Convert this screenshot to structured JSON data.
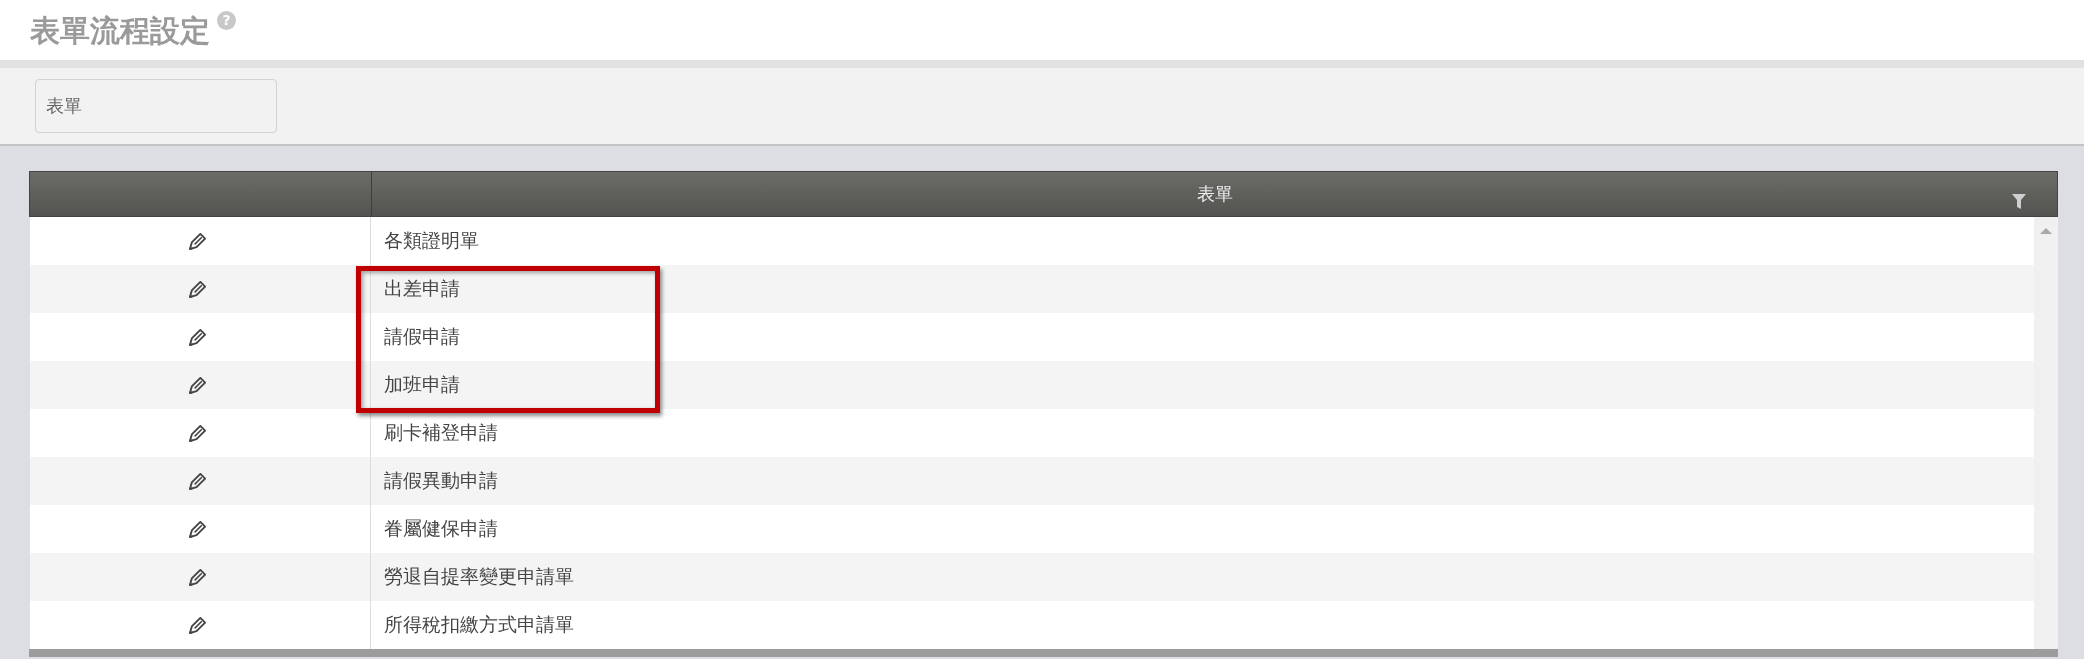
{
  "page": {
    "title": "表單流程設定",
    "help": "?"
  },
  "filter_panel": {
    "fields": [
      {
        "label": "表單"
      }
    ]
  },
  "table": {
    "columns": [
      {
        "label": "表單"
      }
    ],
    "rows": [
      {
        "name": "各類證明單",
        "highlighted": false
      },
      {
        "name": "出差申請",
        "highlighted": true
      },
      {
        "name": "請假申請",
        "highlighted": true
      },
      {
        "name": "加班申請",
        "highlighted": true
      },
      {
        "name": "刷卡補登申請",
        "highlighted": false
      },
      {
        "name": "請假異動申請",
        "highlighted": false
      },
      {
        "name": "眷屬健保申請",
        "highlighted": false
      },
      {
        "name": "勞退自提率變更申請單",
        "highlighted": false
      },
      {
        "name": "所得稅扣繳方式申請單",
        "highlighted": false
      }
    ]
  }
}
